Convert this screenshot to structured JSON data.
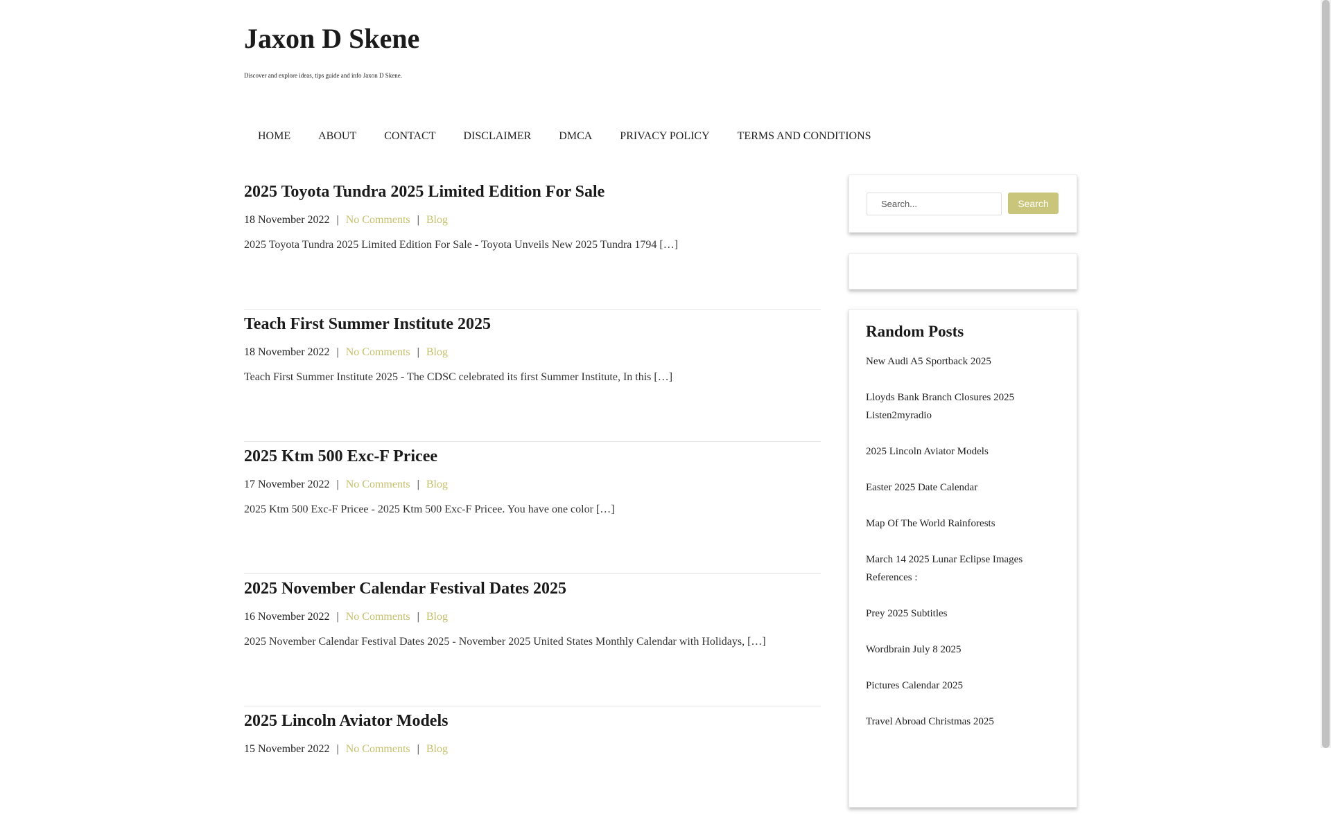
{
  "header": {
    "site_title": "Jaxon D Skene",
    "site_description": "Discover and explore ideas, tips guide and info Jaxon D Skene."
  },
  "nav": {
    "items": [
      "HOME",
      "ABOUT",
      "CONTACT",
      "DISCLAIMER",
      "DMCA",
      "PRIVACY POLICY",
      "TERMS AND CONDITIONS"
    ]
  },
  "posts": [
    {
      "title": "2025 Toyota Tundra 2025 Limited Edition For Sale",
      "date": "18 November 2022",
      "comments": "No Comments",
      "category": "Blog",
      "excerpt": "2025 Toyota Tundra 2025 Limited Edition For Sale - Toyota Unveils New 2025 Tundra 1794 […]"
    },
    {
      "title": "Teach First Summer Institute 2025",
      "date": "18 November 2022",
      "comments": "No Comments",
      "category": "Blog",
      "excerpt": "Teach First Summer Institute 2025 - The CDSC celebrated its first Summer Institute, In this […]"
    },
    {
      "title": "2025 Ktm 500 Exc-F Pricee",
      "date": "17 November 2022",
      "comments": "No Comments",
      "category": "Blog",
      "excerpt": "2025 Ktm 500 Exc-F Pricee - 2025 Ktm 500 Exc-F Pricee. You have one color […]"
    },
    {
      "title": "2025 November Calendar Festival Dates 2025",
      "date": "16 November 2022",
      "comments": "No Comments",
      "category": "Blog",
      "excerpt": "2025 November Calendar Festival Dates 2025 - November 2025 United States Monthly Calendar with Holidays, […]"
    },
    {
      "title": "2025 Lincoln Aviator Models",
      "date": "15 November 2022",
      "comments": "No Comments",
      "category": "Blog",
      "excerpt": ""
    }
  ],
  "meta_separator": "|",
  "search": {
    "placeholder": "Search...",
    "button_label": "Search"
  },
  "random_posts": {
    "heading": "Random Posts",
    "items": [
      "New Audi A5 Sportback 2025",
      "Lloyds Bank Branch Closures 2025 Listen2myradio",
      "2025 Lincoln Aviator Models",
      "Easter 2025 Date Calendar",
      "Map Of The World Rainforests",
      "March 14 2025 Lunar Eclipse Images References :",
      "Prey 2025 Subtitles",
      "Wordbrain July 8 2025",
      "Pictures Calendar 2025",
      "Travel Abroad Christmas 2025"
    ]
  },
  "colors": {
    "accent_link": "#c5c06b",
    "search_button": "#c9c57b"
  }
}
